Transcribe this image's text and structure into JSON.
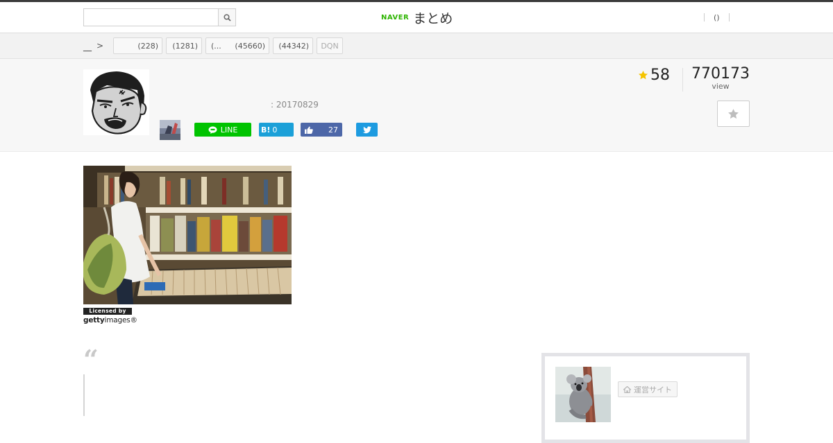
{
  "header": {
    "search_placeholder": "",
    "logo_naver": "NAVER",
    "logo_matome": "まとめ",
    "links": [
      "()"
    ]
  },
  "breadcrumb": {
    "home": "__",
    "chevron": ">"
  },
  "categories": [
    {
      "label": "",
      "count": "(228)"
    },
    {
      "label": "",
      "count": "(1281)"
    },
    {
      "label": "(...",
      "count": "(45660)"
    },
    {
      "label": "",
      "count": "(44342)"
    },
    {
      "label": "DQN",
      "count": ""
    }
  ],
  "matome": {
    "date": ": 20170829",
    "favorites": "58",
    "views": "770173",
    "views_label": "view"
  },
  "share": {
    "line_label": "LINE",
    "hatena_label": "B!",
    "hatena_count": "0",
    "facebook_count": "27"
  },
  "image_credit": {
    "licensed_by": "Licensed by",
    "getty_bold": "getty",
    "getty_rest": "images®"
  },
  "quote": {
    "mark": "“"
  },
  "sidebar": {
    "site_button_label": "運営サイト"
  },
  "colors": {
    "naver_green": "#2db400",
    "line_green": "#00c300",
    "hatena_blue": "#1ba0d8",
    "facebook_blue": "#4d67a8",
    "twitter_blue": "#1d9be0",
    "star_gold": "#f5c400"
  }
}
